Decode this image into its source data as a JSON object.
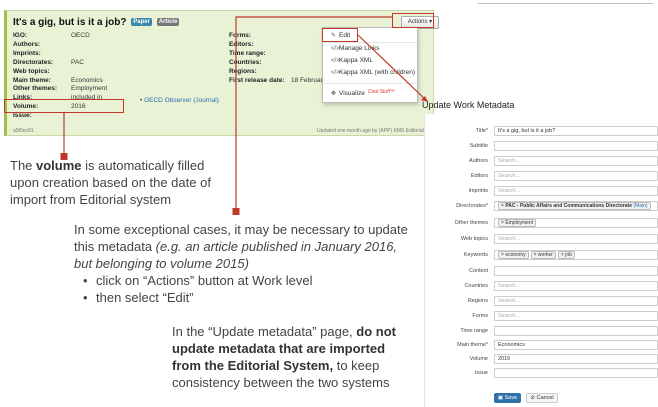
{
  "work": {
    "title": "It's a gig, but is it a job?",
    "badges": [
      "Paper",
      "Article"
    ],
    "actions_label": "Actions ▾",
    "left_fields": [
      {
        "label": "IGO:",
        "value": "OECD"
      },
      {
        "label": "Authors:",
        "value": ""
      },
      {
        "label": "Imprints:",
        "value": ""
      },
      {
        "label": "Directorates:",
        "value": "PAC"
      },
      {
        "label": "Web topics:",
        "value": ""
      },
      {
        "label": "Main theme:",
        "value": "Economics"
      },
      {
        "label": "Other themes:",
        "value": "Employment"
      },
      {
        "label": "Links:",
        "value": "included in"
      },
      {
        "label": "Volume:",
        "value": "2016"
      },
      {
        "label": "Issue:",
        "value": ""
      }
    ],
    "link_value": "OECD Observer (Journal)",
    "right_fields": [
      {
        "label": "Forms:",
        "value": ""
      },
      {
        "label": "Editors:",
        "value": ""
      },
      {
        "label": "Time range:",
        "value": ""
      },
      {
        "label": "Countries:",
        "value": ""
      },
      {
        "label": "Regions:",
        "value": ""
      },
      {
        "label": "First release date:",
        "value": "18 February 20"
      }
    ],
    "footer_left": "a5f0ce91",
    "footer_right": "Updated one month ago by (APP) XMS Editorial Sy"
  },
  "dropdown": {
    "items": [
      {
        "icon": "pencil-icon",
        "glyph": "✎",
        "label": "Edit"
      },
      {
        "icon": "code-icon",
        "glyph": "</>",
        "label": "Manage Links"
      },
      {
        "icon": "code-icon",
        "glyph": "</>",
        "label": "Kappa XML"
      },
      {
        "icon": "code-icon",
        "glyph": "</>",
        "label": "Kappa XML (with children)"
      },
      {
        "icon": "eye-icon",
        "glyph": "✥",
        "label": "Visualize"
      }
    ],
    "cool_note": "Cool Stuff™"
  },
  "callouts": {
    "volume_text_pre": "The ",
    "volume_text_bold": "volume",
    "volume_text_post": " is automatically filled upon creation based on the date of import from Editorial system",
    "exception_text": "In some exceptional cases, it may be necessary to update this metadata ",
    "exception_italic": "(e.g. an article published in January 2016, but belonging to volume 2015)",
    "steps": [
      "click on “Actions” button at Work level",
      "then select “Edit”"
    ],
    "update_pre": "In the “Update metadata” page, ",
    "update_bold": "do not update metadata that are imported from the Editorial System,",
    "update_post": " to keep consistency between the two systems"
  },
  "form": {
    "title": "Update Work Metadata",
    "search_placeholder": "Search...",
    "title_value": "It's a gig, but is it a job?",
    "directorate_chip": "PAC - Public Affairs and Communications Directorate",
    "directorate_main": "(Main)",
    "other_theme_chip": "Employment",
    "keyword_chips": [
      "economy",
      "worker",
      "job"
    ],
    "main_theme_value": "Economics",
    "volume_value": "2016",
    "labels": {
      "title": "Title*",
      "subtitle": "Subtitle",
      "authors": "Authors",
      "editors": "Editors",
      "imprints": "Imprints",
      "directorates": "Directorates*",
      "other_themes": "Other themes",
      "web_topics": "Web topics",
      "keywords": "Keywords",
      "context": "Context",
      "countries": "Countries",
      "regions": "Regions",
      "forms": "Forms",
      "time_range": "Time range",
      "main_theme": "Main theme*",
      "volume": "Volume",
      "issue": "Issue"
    },
    "save_label": "Save",
    "cancel_label": "Cancel"
  }
}
